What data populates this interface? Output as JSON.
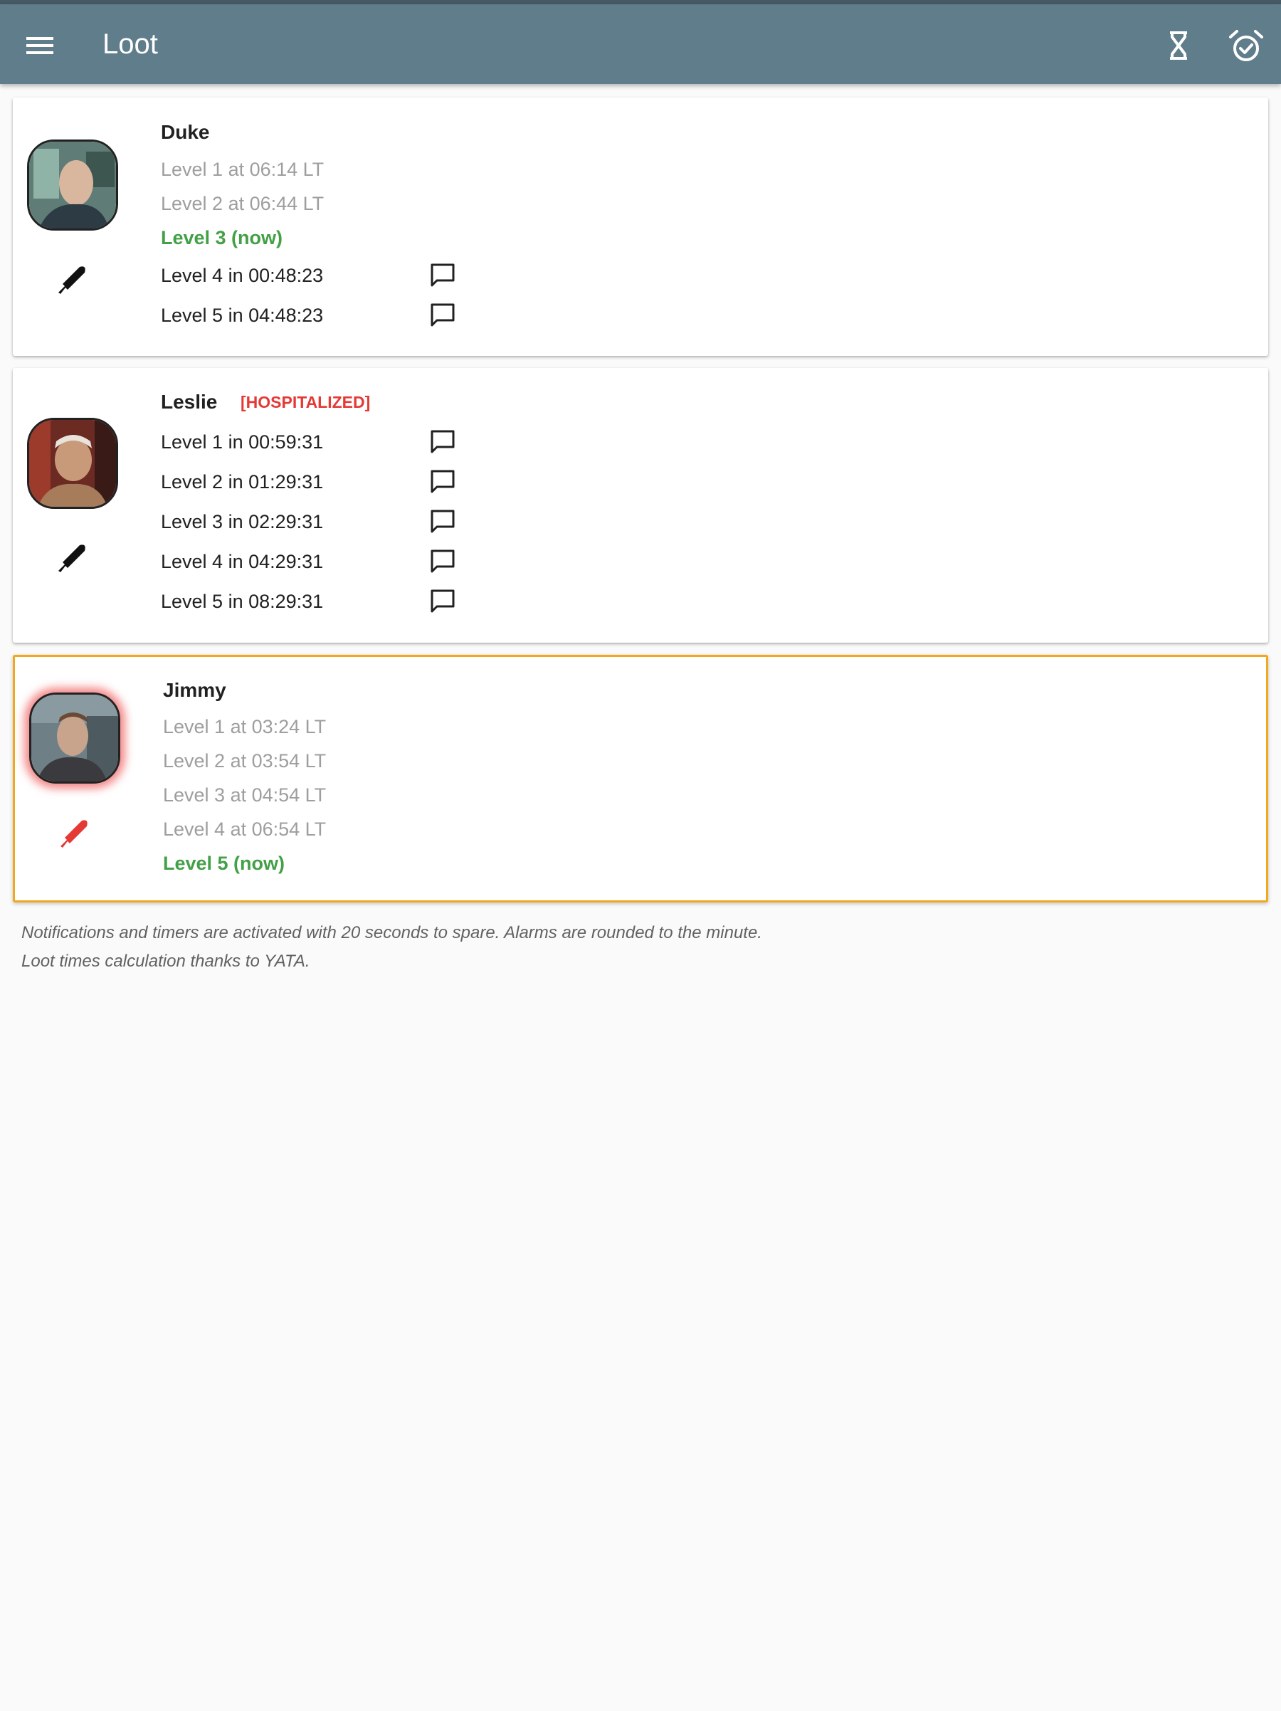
{
  "app": {
    "title": "Loot"
  },
  "appbar_icons": [
    "menu-icon",
    "hourglass-icon",
    "alarm-check-icon"
  ],
  "colors": {
    "appbar": "#607d8b",
    "now": "#43a047",
    "hospitalized": "#e53935",
    "active_border": "#f0a81f",
    "knife_default": "#111111",
    "knife_alert": "#e53935"
  },
  "npcs": [
    {
      "name": "Duke",
      "status": "",
      "levels": [
        {
          "text": "Level 1 at 06:14 LT",
          "state": "past"
        },
        {
          "text": "Level 2 at 06:44 LT",
          "state": "past"
        },
        {
          "text": "Level 3 (now)",
          "state": "now"
        },
        {
          "text": "Level 4 in 00:48:23",
          "state": "future"
        },
        {
          "text": "Level 5 in 04:48:23",
          "state": "future"
        }
      ]
    },
    {
      "name": "Leslie",
      "status": "[HOSPITALIZED]",
      "levels": [
        {
          "text": "Level 1 in 00:59:31",
          "state": "future"
        },
        {
          "text": "Level 2 in 01:29:31",
          "state": "future"
        },
        {
          "text": "Level 3 in 02:29:31",
          "state": "future"
        },
        {
          "text": "Level 4 in 04:29:31",
          "state": "future"
        },
        {
          "text": "Level 5 in 08:29:31",
          "state": "future"
        }
      ]
    },
    {
      "name": "Jimmy",
      "status": "",
      "levels": [
        {
          "text": "Level 1 at 03:24 LT",
          "state": "past"
        },
        {
          "text": "Level 2 at 03:54 LT",
          "state": "past"
        },
        {
          "text": "Level 3 at 04:54 LT",
          "state": "past"
        },
        {
          "text": "Level 4 at 06:54 LT",
          "state": "past"
        },
        {
          "text": "Level 5 (now)",
          "state": "now"
        }
      ]
    }
  ],
  "footer": {
    "line1": "Notifications and timers are activated with 20 seconds to spare. Alarms are rounded to the minute.",
    "line2": "Loot times calculation thanks to YATA."
  }
}
